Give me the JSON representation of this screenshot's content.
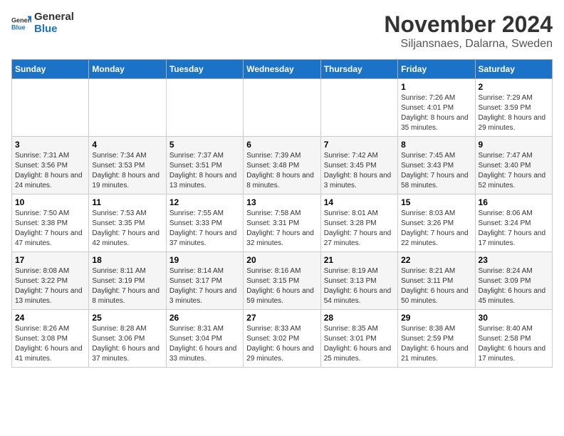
{
  "logo": {
    "line1": "General",
    "line2": "Blue"
  },
  "title": "November 2024",
  "location": "Siljansnaes, Dalarna, Sweden",
  "days_of_week": [
    "Sunday",
    "Monday",
    "Tuesday",
    "Wednesday",
    "Thursday",
    "Friday",
    "Saturday"
  ],
  "weeks": [
    [
      {
        "day": "",
        "info": ""
      },
      {
        "day": "",
        "info": ""
      },
      {
        "day": "",
        "info": ""
      },
      {
        "day": "",
        "info": ""
      },
      {
        "day": "",
        "info": ""
      },
      {
        "day": "1",
        "info": "Sunrise: 7:26 AM\nSunset: 4:01 PM\nDaylight: 8 hours and 35 minutes."
      },
      {
        "day": "2",
        "info": "Sunrise: 7:29 AM\nSunset: 3:59 PM\nDaylight: 8 hours and 29 minutes."
      }
    ],
    [
      {
        "day": "3",
        "info": "Sunrise: 7:31 AM\nSunset: 3:56 PM\nDaylight: 8 hours and 24 minutes."
      },
      {
        "day": "4",
        "info": "Sunrise: 7:34 AM\nSunset: 3:53 PM\nDaylight: 8 hours and 19 minutes."
      },
      {
        "day": "5",
        "info": "Sunrise: 7:37 AM\nSunset: 3:51 PM\nDaylight: 8 hours and 13 minutes."
      },
      {
        "day": "6",
        "info": "Sunrise: 7:39 AM\nSunset: 3:48 PM\nDaylight: 8 hours and 8 minutes."
      },
      {
        "day": "7",
        "info": "Sunrise: 7:42 AM\nSunset: 3:45 PM\nDaylight: 8 hours and 3 minutes."
      },
      {
        "day": "8",
        "info": "Sunrise: 7:45 AM\nSunset: 3:43 PM\nDaylight: 7 hours and 58 minutes."
      },
      {
        "day": "9",
        "info": "Sunrise: 7:47 AM\nSunset: 3:40 PM\nDaylight: 7 hours and 52 minutes."
      }
    ],
    [
      {
        "day": "10",
        "info": "Sunrise: 7:50 AM\nSunset: 3:38 PM\nDaylight: 7 hours and 47 minutes."
      },
      {
        "day": "11",
        "info": "Sunrise: 7:53 AM\nSunset: 3:35 PM\nDaylight: 7 hours and 42 minutes."
      },
      {
        "day": "12",
        "info": "Sunrise: 7:55 AM\nSunset: 3:33 PM\nDaylight: 7 hours and 37 minutes."
      },
      {
        "day": "13",
        "info": "Sunrise: 7:58 AM\nSunset: 3:31 PM\nDaylight: 7 hours and 32 minutes."
      },
      {
        "day": "14",
        "info": "Sunrise: 8:01 AM\nSunset: 3:28 PM\nDaylight: 7 hours and 27 minutes."
      },
      {
        "day": "15",
        "info": "Sunrise: 8:03 AM\nSunset: 3:26 PM\nDaylight: 7 hours and 22 minutes."
      },
      {
        "day": "16",
        "info": "Sunrise: 8:06 AM\nSunset: 3:24 PM\nDaylight: 7 hours and 17 minutes."
      }
    ],
    [
      {
        "day": "17",
        "info": "Sunrise: 8:08 AM\nSunset: 3:22 PM\nDaylight: 7 hours and 13 minutes."
      },
      {
        "day": "18",
        "info": "Sunrise: 8:11 AM\nSunset: 3:19 PM\nDaylight: 7 hours and 8 minutes."
      },
      {
        "day": "19",
        "info": "Sunrise: 8:14 AM\nSunset: 3:17 PM\nDaylight: 7 hours and 3 minutes."
      },
      {
        "day": "20",
        "info": "Sunrise: 8:16 AM\nSunset: 3:15 PM\nDaylight: 6 hours and 59 minutes."
      },
      {
        "day": "21",
        "info": "Sunrise: 8:19 AM\nSunset: 3:13 PM\nDaylight: 6 hours and 54 minutes."
      },
      {
        "day": "22",
        "info": "Sunrise: 8:21 AM\nSunset: 3:11 PM\nDaylight: 6 hours and 50 minutes."
      },
      {
        "day": "23",
        "info": "Sunrise: 8:24 AM\nSunset: 3:09 PM\nDaylight: 6 hours and 45 minutes."
      }
    ],
    [
      {
        "day": "24",
        "info": "Sunrise: 8:26 AM\nSunset: 3:08 PM\nDaylight: 6 hours and 41 minutes."
      },
      {
        "day": "25",
        "info": "Sunrise: 8:28 AM\nSunset: 3:06 PM\nDaylight: 6 hours and 37 minutes."
      },
      {
        "day": "26",
        "info": "Sunrise: 8:31 AM\nSunset: 3:04 PM\nDaylight: 6 hours and 33 minutes."
      },
      {
        "day": "27",
        "info": "Sunrise: 8:33 AM\nSunset: 3:02 PM\nDaylight: 6 hours and 29 minutes."
      },
      {
        "day": "28",
        "info": "Sunrise: 8:35 AM\nSunset: 3:01 PM\nDaylight: 6 hours and 25 minutes."
      },
      {
        "day": "29",
        "info": "Sunrise: 8:38 AM\nSunset: 2:59 PM\nDaylight: 6 hours and 21 minutes."
      },
      {
        "day": "30",
        "info": "Sunrise: 8:40 AM\nSunset: 2:58 PM\nDaylight: 6 hours and 17 minutes."
      }
    ]
  ]
}
